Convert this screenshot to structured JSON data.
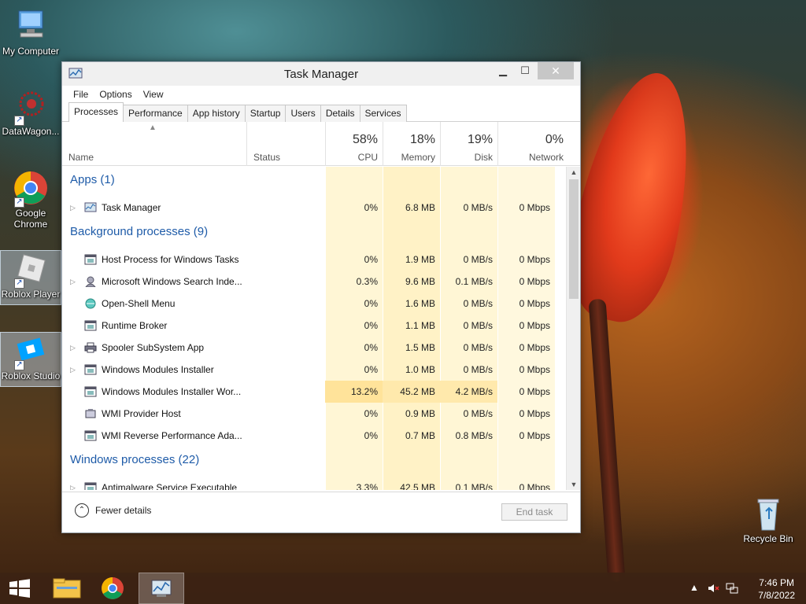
{
  "desktop": {
    "icons": [
      {
        "label": "My Computer"
      },
      {
        "label": "DataWagon..."
      },
      {
        "label": "Google Chrome"
      },
      {
        "label": "Roblox Player"
      },
      {
        "label": "Roblox Studio"
      },
      {
        "label": "Recycle Bin"
      }
    ]
  },
  "window": {
    "title": "Task Manager",
    "close_glyph": "✕",
    "min_glyph": "▁",
    "max_glyph": "☐"
  },
  "menu": [
    "File",
    "Options",
    "View"
  ],
  "tabs": [
    "Processes",
    "Performance",
    "App history",
    "Startup",
    "Users",
    "Details",
    "Services"
  ],
  "header": {
    "name": "Name",
    "status": "Status",
    "cpu": {
      "pct": "58%",
      "label": "CPU"
    },
    "memory": {
      "pct": "18%",
      "label": "Memory"
    },
    "disk": {
      "pct": "19%",
      "label": "Disk"
    },
    "network": {
      "pct": "0%",
      "label": "Network"
    }
  },
  "groups": {
    "apps": "Apps (1)",
    "background": "Background processes (9)",
    "windows": "Windows processes (22)"
  },
  "processes": [
    {
      "name": "Task Manager",
      "cpu": "0%",
      "mem": "6.8 MB",
      "disk": "0 MB/s",
      "net": "0 Mbps"
    },
    {
      "name": "Host Process for Windows Tasks",
      "cpu": "0%",
      "mem": "1.9 MB",
      "disk": "0 MB/s",
      "net": "0 Mbps"
    },
    {
      "name": "Microsoft Windows Search Inde...",
      "cpu": "0.3%",
      "mem": "9.6 MB",
      "disk": "0.1 MB/s",
      "net": "0 Mbps"
    },
    {
      "name": "Open-Shell Menu",
      "cpu": "0%",
      "mem": "1.6 MB",
      "disk": "0 MB/s",
      "net": "0 Mbps"
    },
    {
      "name": "Runtime Broker",
      "cpu": "0%",
      "mem": "1.1 MB",
      "disk": "0 MB/s",
      "net": "0 Mbps"
    },
    {
      "name": "Spooler SubSystem App",
      "cpu": "0%",
      "mem": "1.5 MB",
      "disk": "0 MB/s",
      "net": "0 Mbps"
    },
    {
      "name": "Windows Modules Installer",
      "cpu": "0%",
      "mem": "1.0 MB",
      "disk": "0 MB/s",
      "net": "0 Mbps"
    },
    {
      "name": "Windows Modules Installer Wor...",
      "cpu": "13.2%",
      "mem": "45.2 MB",
      "disk": "4.2 MB/s",
      "net": "0 Mbps"
    },
    {
      "name": "WMI Provider Host",
      "cpu": "0%",
      "mem": "0.9 MB",
      "disk": "0 MB/s",
      "net": "0 Mbps"
    },
    {
      "name": "WMI Reverse Performance Ada...",
      "cpu": "0%",
      "mem": "0.7 MB",
      "disk": "0.8 MB/s",
      "net": "0 Mbps"
    },
    {
      "name": "Antimalware Service Executable",
      "cpu": "3.3%",
      "mem": "42.5 MB",
      "disk": "0.1 MB/s",
      "net": "0 Mbps"
    }
  ],
  "footer": {
    "fewer_details": "Fewer details",
    "end_task": "End task"
  },
  "taskbar": {
    "time": "7:46 PM",
    "date": "7/8/2022"
  },
  "colors": {
    "group_text": "#1e5ba8",
    "heat_light": "#fff8dc",
    "heat_mid": "#fff1c4",
    "heat_strong": "#ffe39a"
  }
}
